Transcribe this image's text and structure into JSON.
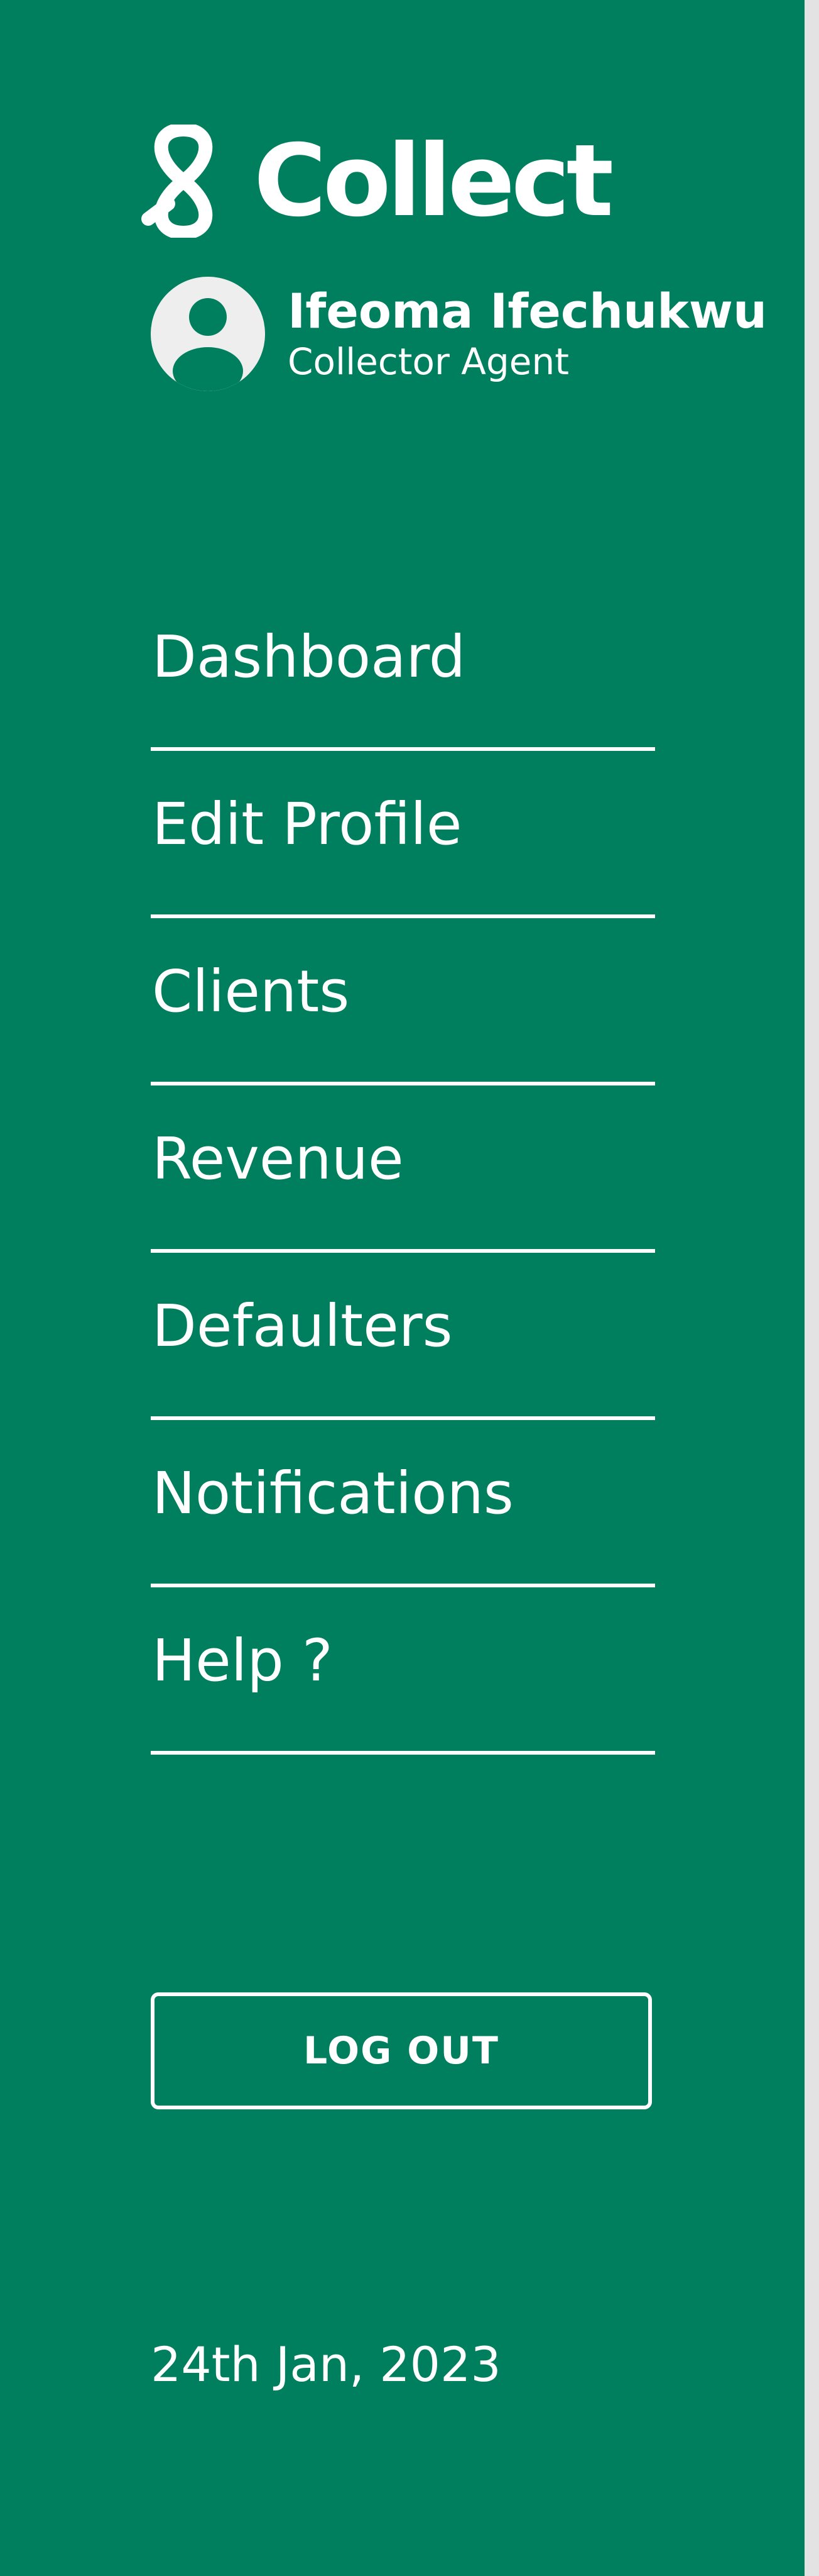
{
  "brand": {
    "name": "Collect",
    "icon": "collect-logo-icon"
  },
  "user": {
    "name": "Ifeoma Ifechukwu",
    "role": "Collector Agent",
    "avatar_icon": "user-avatar-icon"
  },
  "nav": {
    "items": [
      {
        "label": "Dashboard"
      },
      {
        "label": "Edit Profile"
      },
      {
        "label": "Clients"
      },
      {
        "label": "Revenue"
      },
      {
        "label": "Defaulters"
      },
      {
        "label": "Notifications"
      },
      {
        "label": "Help ?"
      }
    ]
  },
  "logout": {
    "label": "LOG OUT"
  },
  "footer": {
    "date": "24th Jan, 2023"
  },
  "colors": {
    "sidebar_bg": "#007F5F",
    "text": "#FFFFFF",
    "avatar_bg": "#EEEEEE"
  }
}
